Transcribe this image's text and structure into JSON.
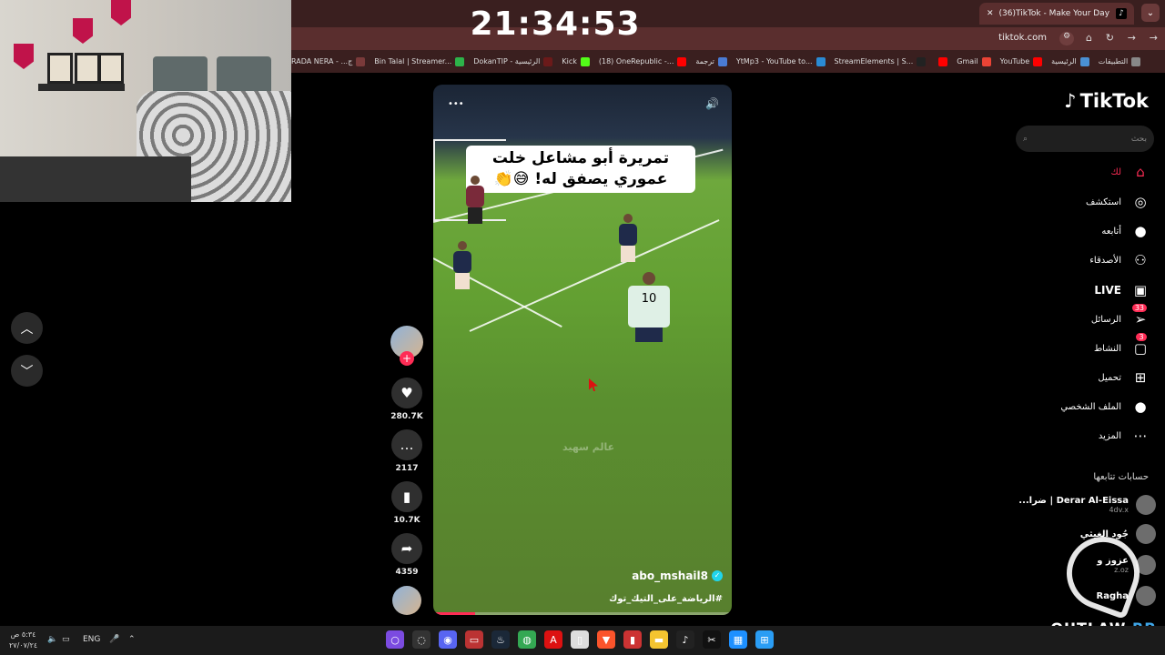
{
  "clock": "21:34:53",
  "browser": {
    "tab_title": "(36)TikTok - Make Your Day",
    "tab_close": "✕",
    "new_tab": "+",
    "url": "tiktok.com",
    "bookmarks": [
      {
        "label": "RADA NERA - ...ج",
        "color": "#7a3a3a"
      },
      {
        "label": "Bin Talal | Streamer...",
        "color": "#2db34a"
      },
      {
        "label": "DokanTIP - الرئيسية",
        "color": "#6b1a1a"
      },
      {
        "label": "Kick",
        "color": "#53fc18"
      },
      {
        "label": "(18) OneRepublic -...",
        "color": "#ff0000"
      },
      {
        "label": "ترجمة",
        "color": "#4a7bd4"
      },
      {
        "label": "YtMp3 - YouTube to...",
        "color": "#2a8bd4"
      },
      {
        "label": "StreamElements | S...",
        "color": "#222222"
      },
      {
        "label": "",
        "color": "#ff0000"
      },
      {
        "label": "Gmail",
        "color": "#ea4335"
      },
      {
        "label": "YouTube",
        "color": "#ff0000"
      },
      {
        "label": "الرئيسية",
        "color": "#4a90d4"
      },
      {
        "label": "التطبيقات",
        "color": "#888888"
      }
    ]
  },
  "video": {
    "caption": "تمريرة أبو مشاعل خلت عموري يصفق له! 😅👏",
    "author": "abo_mshail8",
    "hashtag": "#الرياضة_على_التيك_توك",
    "watermark": "عالم سهيد",
    "progress": 0.14
  },
  "actions": {
    "likes": "280.7K",
    "comments": "2117",
    "saves": "10.7K",
    "shares": "4359"
  },
  "sidebar": {
    "logo": "TikTok",
    "search_placeholder": "بحث",
    "nav": [
      {
        "label": "لك",
        "icon": "home-icon",
        "active": true
      },
      {
        "label": "استكشف",
        "icon": "explore-icon"
      },
      {
        "label": "أتابعه",
        "icon": "following-icon"
      },
      {
        "label": "الأصدقاء",
        "icon": "friends-icon"
      },
      {
        "label": "LIVE",
        "icon": "live-icon"
      },
      {
        "label": "الرسائل",
        "icon": "messages-icon",
        "badge": "33"
      },
      {
        "label": "النشاط",
        "icon": "activity-icon",
        "badge": "3"
      },
      {
        "label": "تحميل",
        "icon": "upload-icon"
      },
      {
        "label": "الملف الشخصي",
        "icon": "profile-icon"
      },
      {
        "label": "المزيد",
        "icon": "more-icon"
      }
    ],
    "following_title": "حسابات تتابعها",
    "following": [
      {
        "name": "Derar Al-Eissa | ضرا...",
        "handle": "4dv.x"
      },
      {
        "name": "جُود الغيثي",
        "handle": ""
      },
      {
        "name": "عزوز و",
        "handle": "z.oz"
      },
      {
        "name": "Ragha",
        "handle": ""
      }
    ],
    "overlay_text_1": "OUTLAW",
    "overlay_text_2": "RP"
  },
  "taskbar": {
    "time": "٥:٣٤ ص",
    "date": "٢٧/٠٧/٢٤",
    "lang": "ENG"
  }
}
